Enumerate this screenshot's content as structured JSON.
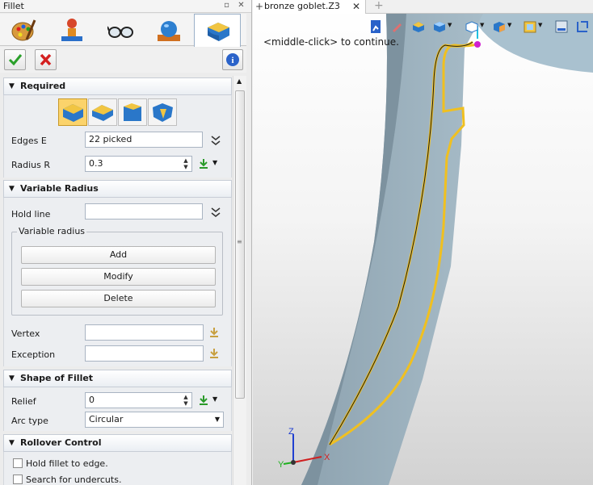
{
  "window": {
    "title": "Fillet"
  },
  "doc_tabs": [
    {
      "label": "bronze goblet.Z3"
    }
  ],
  "viewport": {
    "hint": "<middle-click> to continue.",
    "axis_labels": {
      "z": "Z",
      "y": "Y",
      "x": "X"
    }
  },
  "required": {
    "header": "Required",
    "edges_label": "Edges E",
    "edges_value": "22 picked",
    "radius_label": "Radius R",
    "radius_value": "0.3"
  },
  "variable_radius": {
    "header": "Variable Radius",
    "hold_line_label": "Hold line",
    "hold_line_value": "",
    "group_label": "Variable radius",
    "add_label": "Add",
    "modify_label": "Modify",
    "delete_label": "Delete",
    "vertex_label": "Vertex",
    "vertex_value": "",
    "exception_label": "Exception",
    "exception_value": ""
  },
  "shape": {
    "header": "Shape of Fillet",
    "relief_label": "Relief",
    "relief_value": "0",
    "arc_label": "Arc type",
    "arc_value": "Circular"
  },
  "rollover": {
    "header": "Rollover Control",
    "hold_edge_label": "Hold fillet to edge.",
    "hold_edge_checked": false,
    "undercuts_label": "Search for undercuts.",
    "undercuts_checked": false
  },
  "colors": {
    "accent": "#3b7dd8",
    "fillet_edge": "#f0c020",
    "model": "#8fa6b3",
    "background": "#ffffff"
  }
}
